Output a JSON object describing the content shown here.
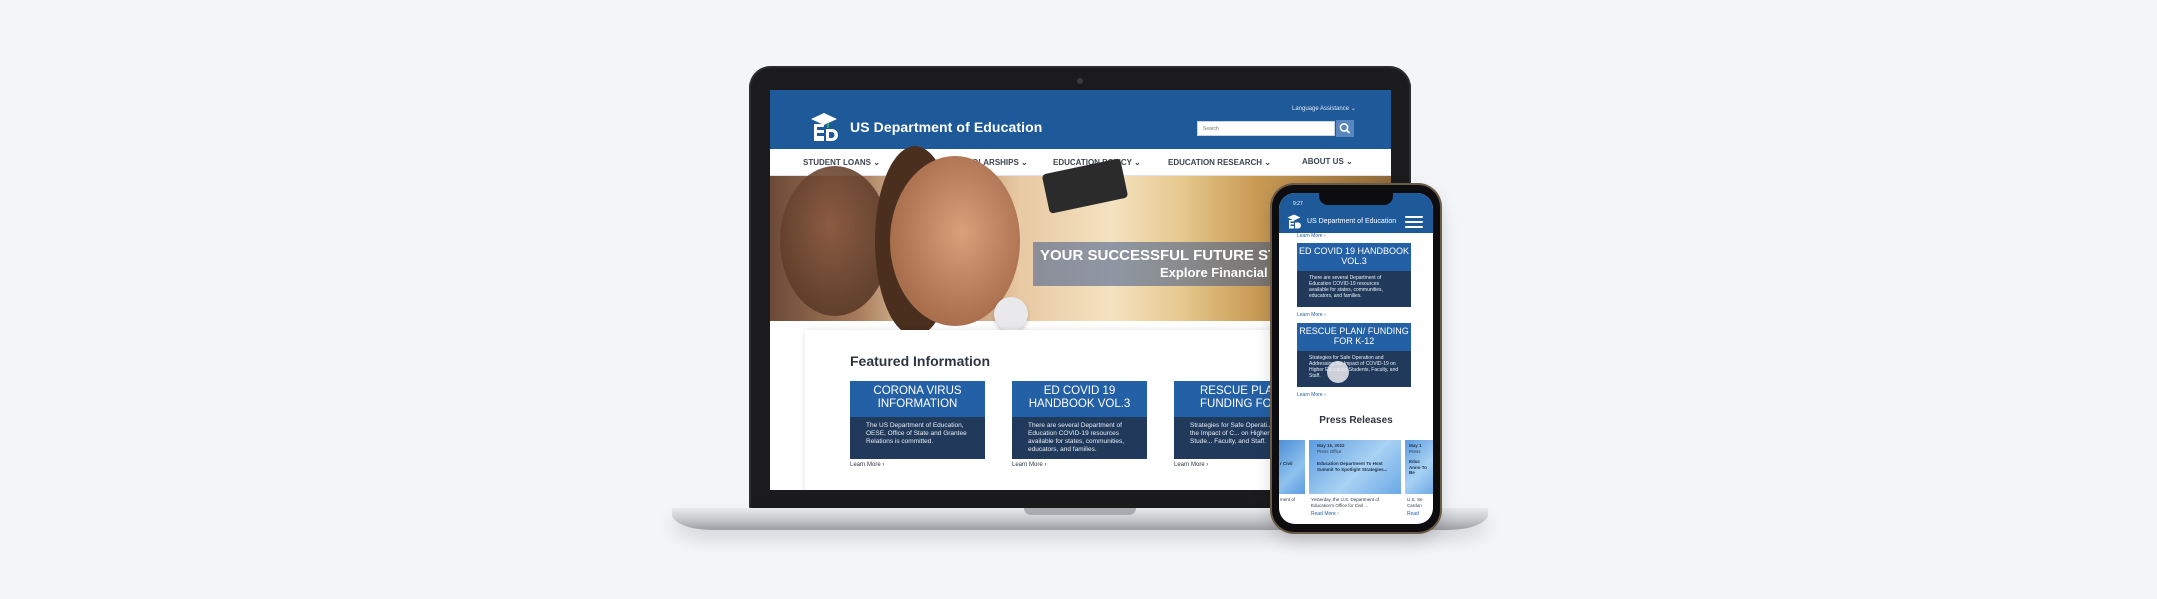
{
  "laptop": {
    "language_assistance": "Language Assistance ⌄",
    "site_title": "US Department of Education",
    "search_placeholder": "Search",
    "nav": [
      {
        "label": "STUDENT LOANS ⌄"
      },
      {
        "label": "GRANTS AND SCHOLARSHIPS ⌄"
      },
      {
        "label": "EDUCATION POLICY ⌄"
      },
      {
        "label": "EDUCATION RESEARCH ⌄"
      },
      {
        "label": "ABOUT US ⌄"
      }
    ],
    "hero": {
      "line1": "YOUR SUCCESSFUL FUTURE STA",
      "line2": "Explore Financial A"
    },
    "featured_title": "Featured Information",
    "cards": [
      {
        "title": "CORONA VIRUS INFORMATION",
        "body": "The US Department of Education, OESE, Office of State and Grantee Relations is committed.",
        "learn": "Learn More ›"
      },
      {
        "title": "ED COVID 19 HANDBOOK VOL.3",
        "body": "There are several Department of Education COVID-19 resources available for states, communities, educators, and families.",
        "learn": "Learn More ›"
      },
      {
        "title": "RESCUE PLAN/ FUNDING FOR K",
        "body": "Strategies for Safe Operati... Addressing the Impact of C... on Higher Education Stude... Faculty, and Staff.",
        "learn": "Learn More ›"
      }
    ]
  },
  "phone": {
    "time": "9:27",
    "site_title": "US Department of Education",
    "top_learn": "Learn More ›",
    "cards": [
      {
        "title": "ED COVID 19 HANDBOOK VOL.3",
        "body": "There are several Department of Education COVID-19 resources available for states, communities, educators, and families.",
        "learn": "Learn More ›"
      },
      {
        "title": "RESCUE PLAN/ FUNDING FOR K-12",
        "body": "Strategies for Safe Operation and Addressing the Impact of COVID-19 on Higher Education Students, Faculty, and Staff.",
        "learn": "Learn More ›"
      }
    ],
    "press_title": "Press Releases",
    "press": [
      {
        "date": "",
        "text": "r Civil",
        "snippet": "ment of"
      },
      {
        "date": "May 16, 2022",
        "office": "Press Office",
        "text": "Education Department To Host Summit To Spotlight Strategies...",
        "snippet": "Yesterday, the U.S. Department of Education's Office for Civil ...",
        "read": "Read More ›"
      },
      {
        "date": "May 1",
        "office": "Press",
        "text": "Educ Anno To Be",
        "snippet": "U.S. Se Cardon",
        "read": "Read"
      }
    ]
  },
  "colors": {
    "brand_blue": "#1e5a9a",
    "card_blue": "#2460a6",
    "card_dark": "#213a5c"
  }
}
